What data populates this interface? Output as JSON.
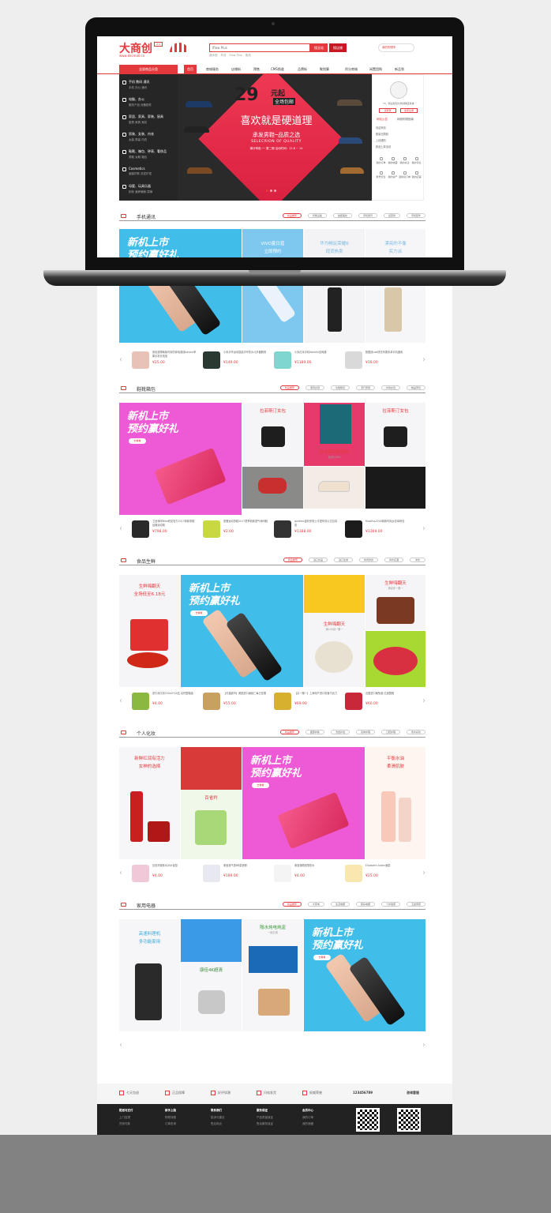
{
  "header": {
    "logo": "大商创",
    "logo_url": "www.dscmall.cn",
    "logo_badge": "2.0",
    "search_placeholder": "Iflow Plus",
    "search_btn": "搜全站",
    "search_shop_btn": "搜店铺",
    "hot_words": [
      "酒水馆",
      "外设",
      "Flow Plus",
      "索机"
    ],
    "cart": "我的购物车"
  },
  "nav": {
    "category_head": "全部商品分类",
    "items": [
      "首页",
      "商城服务",
      "店铺街",
      "预售",
      "CMS频道",
      "品牌街",
      "聚划算",
      "积分商城",
      "闲置团购",
      "新品到"
    ]
  },
  "categories": [
    {
      "title": "手机 数码 通讯",
      "sub": "手机 办公 通讯"
    },
    {
      "title": "电脑、办公",
      "sub": "服务产品 设备配件"
    },
    {
      "title": "家居、家具、家装、厨具",
      "sub": "厨具 家具 家纺"
    },
    {
      "title": "男装、女装、内衣",
      "sub": "女装 男装 内衣"
    },
    {
      "title": "鞋靴、箱包、钟表、奢侈品",
      "sub": "男鞋 女鞋 箱包"
    },
    {
      "title": "Cosmetics",
      "sub": "面部护肤 洗发护发"
    },
    {
      "title": "母婴、玩具乐器",
      "sub": "奶粉 营养辅食 尿裤"
    }
  ],
  "banner": {
    "big": "29",
    "yuan": "元起",
    "free": "全场包邮",
    "main": "喜欢就是硬道理",
    "sub": "承发男鞋─品质之选",
    "en": "SELECRION OF QUALITY",
    "date": "满分驾临 ── 第二期 活动时间：12.8 ~ 14"
  },
  "user": {
    "hi": "Hi，欢迎来到大商创网店系统",
    "login": "请登录",
    "register": "免费注册",
    "tab1": "网站公告",
    "tab2": "网络购物指南",
    "news": [
      "欢迎来到",
      "数量无限制",
      "上线通知",
      "新品上架活动"
    ],
    "icons": [
      "我的订单",
      "我的收藏",
      "我的关注",
      "我的评论",
      "账号安全",
      "我的资产",
      "退换货订单",
      "我的店铺"
    ]
  },
  "floors": [
    {
      "name": "手机通讯",
      "tabs": [
        "新品推荐",
        "智能设备",
        "拍照美妆",
        "手机通讯",
        "运营商",
        "手机配件"
      ],
      "tiles": [
        {
          "t": "新机上市",
          "s": "预约赢好礼"
        },
        {
          "t": "VIVO夏日蓝",
          "s": "立即预约"
        },
        {
          "t": "华为畅玩荣耀6",
          "s": "现货热卖"
        },
        {
          "t": "漂亮的不像",
          "s": "实力派"
        }
      ],
      "promo1": "新机上市",
      "promo2": "预约赢好礼",
      "promo_btn": "去看看",
      "products": [
        {
          "name": "索尼超薄韩版时尚防掉电源线iphone苹果手机充电宝",
          "price": "¥25.00"
        },
        {
          "name": "小米手环运动智能手环防水计步器腕带",
          "price": "¥149.00"
        },
        {
          "name": "小米红米手机Note4X全网通",
          "price": "¥1189.00"
        },
        {
          "name": "数据线usb快充苹果安卓手机通用",
          "price": "¥18.00"
        }
      ]
    },
    {
      "name": "鞋靴箱包",
      "tabs": [
        "新品推荐",
        "潮流女鞋",
        "功能箱包",
        "流行男鞋",
        "时尚女包",
        "精品男包"
      ],
      "tiles": [
        {
          "t": "拉菲斯汀女包",
          "s": ""
        },
        {
          "t": "玛卡莱高跟鞋女",
          "s": "最低价¥99"
        },
        {
          "t": "拉菲斯汀女包",
          "s": ""
        }
      ],
      "promo1": "新机上市",
      "promo2": "预约赢好礼",
      "promo_btn": "去看看",
      "products": [
        {
          "name": "卫龙休闲Nike耐克官方2017新款男鞋 经典运动鞋",
          "price": "¥798.00"
        },
        {
          "name": "驼鹿运动男鞋2017夏季新款透气休闲鞋",
          "price": "¥2.00"
        },
        {
          "name": "goldlion金利来男士手提商务公文包真皮",
          "price": "¥1388.00"
        },
        {
          "name": "KissKiss2016新款时尚女包单肩包",
          "price": "¥3369.00"
        }
      ]
    },
    {
      "name": "食品生鲜",
      "tabs": [
        "新品推荐",
        "进口食品",
        "进口生鲜",
        "休闲零食",
        "中外名酒",
        "冲饮"
      ],
      "tiles": [
        {
          "t": "生鲜嗨翻天",
          "s": "全场低至6.18元"
        },
        {
          "t": "生鲜嗨翻天",
          "s": "满200减一赠一"
        },
        {
          "t": "生鲜嗨翻天",
          "s": "满足你一赠一"
        }
      ],
      "promo1": "新机上市",
      "promo2": "预约赢好礼",
      "promo_btn": "去看看",
      "products": [
        {
          "name": "蒙牛纯牛奶250ml*24盒 高钙整箱装",
          "price": "¥4.00"
        },
        {
          "name": "【天猫超市】美国进口扁桃仁每日坚果",
          "price": "¥55.00"
        },
        {
          "name": "【买一赠一】上海特产进口零食巧克力",
          "price": "¥69.90"
        },
        {
          "name": "法国进口葡萄酒 红酒整箱",
          "price": "¥60.00"
        }
      ]
    },
    {
      "name": "个人化妆",
      "tabs": [
        "新品推荐",
        "面部护肤",
        "洗发护发",
        "身体护理",
        "口腔护理",
        "香水彩妆"
      ],
      "tiles": [
        {
          "t": "新鲜红润有活力",
          "s": "女神的选择"
        },
        {
          "t": "百雀羚",
          "s": ""
        },
        {
          "t": "平衡水油",
          "s": "柔滑肌肤"
        }
      ],
      "promo1": "新机上市",
      "promo2": "预约赢好礼",
      "promo_btn": "去看看",
      "products": [
        {
          "name": "百雀羚爽肤水补水保湿",
          "price": "¥4.00"
        },
        {
          "name": "美宝莲气垫BB霜遮瑕",
          "price": "¥189.00"
        },
        {
          "name": "美宝莲眼线笔防水",
          "price": "¥4.00"
        },
        {
          "name": "Elizabeth Arden面霜",
          "price": "¥25.00"
        }
      ]
    },
    {
      "name": "家用电器",
      "tabs": [
        "新品推荐",
        "大家电",
        "生活电器",
        "厨房电器",
        "个护健康",
        "五金家装"
      ],
      "tiles": [
        {
          "t": "高速料理机",
          "s": "多功能家用"
        },
        {
          "t": "康佳4K超清",
          "s": ""
        },
        {
          "t": "隔水炖电炖盅",
          "s": "一碗五锅"
        }
      ],
      "promo1": "新机上市",
      "promo2": "预约赢好礼",
      "promo_btn": "去看看",
      "products": []
    }
  ],
  "footer": {
    "services": [
      "七天包退",
      "正品保障",
      "好评如潮",
      "闪电发货",
      "权威荣誉"
    ],
    "phone": "123456789",
    "online": "咨询客服",
    "cols": [
      {
        "h": "配送与支付",
        "l": [
          "上门自提",
          "货到付款"
        ]
      },
      {
        "h": "新手上路",
        "l": [
          "购物流程",
          "订单查询"
        ]
      },
      {
        "h": "联系我们",
        "l": [
          "投诉与建议",
          "售后网点"
        ]
      },
      {
        "h": "服务保证",
        "l": [
          "产品质量保证",
          "售后服务保证"
        ]
      },
      {
        "h": "会员中心",
        "l": [
          "我的订单",
          "我的收藏"
        ]
      }
    ]
  }
}
